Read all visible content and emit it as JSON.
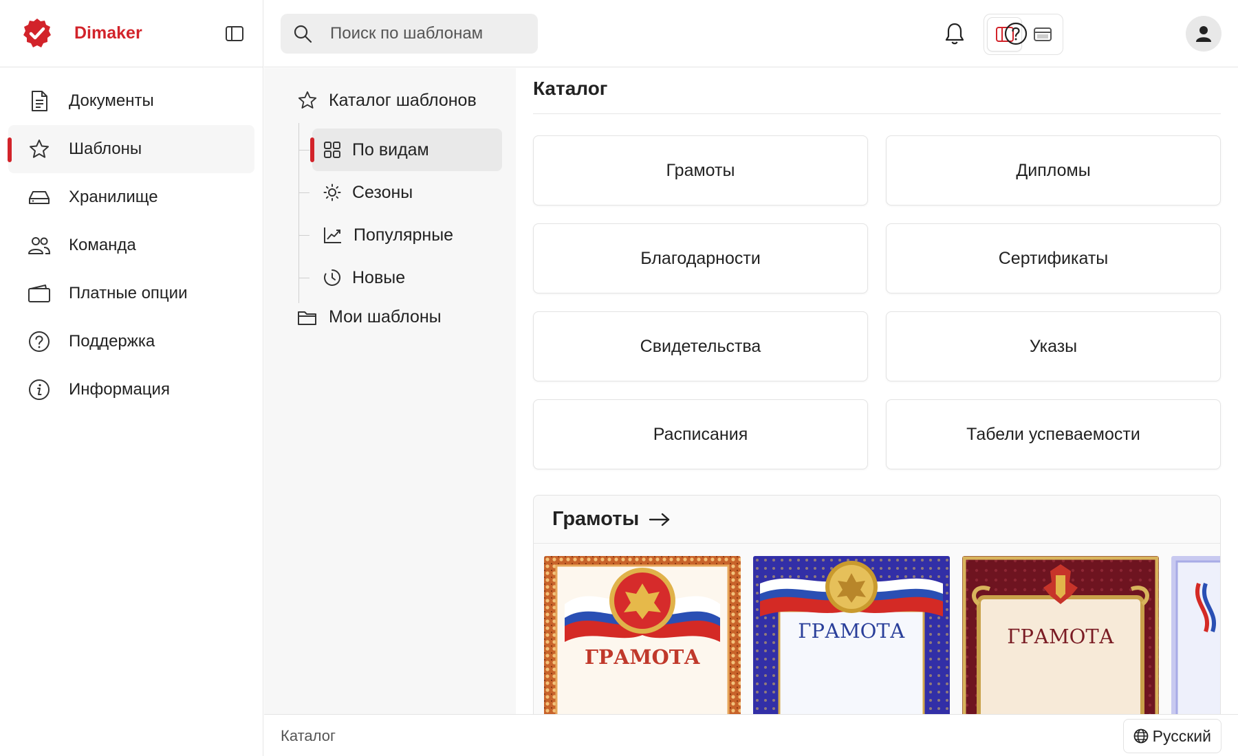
{
  "brand": {
    "name": "Dimaker",
    "accent": "#d2232a"
  },
  "sidebar": {
    "items": [
      {
        "label": "Документы",
        "icon": "document-icon"
      },
      {
        "label": "Шаблоны",
        "icon": "star-icon",
        "active": true
      },
      {
        "label": "Хранилище",
        "icon": "storage-icon"
      },
      {
        "label": "Команда",
        "icon": "team-icon"
      },
      {
        "label": "Платные опции",
        "icon": "wallet-icon"
      },
      {
        "label": "Поддержка",
        "icon": "help-circle-icon"
      },
      {
        "label": "Информация",
        "icon": "info-icon"
      }
    ]
  },
  "topbar": {
    "search_placeholder": "Поиск по шаблонам"
  },
  "subnav": {
    "root": "Каталог шаблонов",
    "children": [
      {
        "label": "По видам",
        "icon": "grid-icon",
        "active": true
      },
      {
        "label": "Сезоны",
        "icon": "sun-icon"
      },
      {
        "label": "Популярные",
        "icon": "trending-icon"
      },
      {
        "label": "Новые",
        "icon": "clock-icon"
      }
    ],
    "mine": "Мои шаблоны"
  },
  "main": {
    "title": "Каталог",
    "categories": [
      "Грамоты",
      "Дипломы",
      "Благодарности",
      "Сертификаты",
      "Свидетельства",
      "Указы",
      "Расписания",
      "Табели успеваемости"
    ],
    "section": {
      "title": "Грамоты",
      "thumbs": [
        {
          "text": "ГРАМОТА",
          "style": "orange-ornament"
        },
        {
          "text": "ГРАМОТА",
          "style": "blue-ornament"
        },
        {
          "text": "ГРАМОТА",
          "style": "burgundy-gold"
        },
        {
          "text": "",
          "style": "lavender-partial"
        }
      ]
    }
  },
  "footer": {
    "breadcrumb": "Каталог",
    "language": "Русский"
  }
}
